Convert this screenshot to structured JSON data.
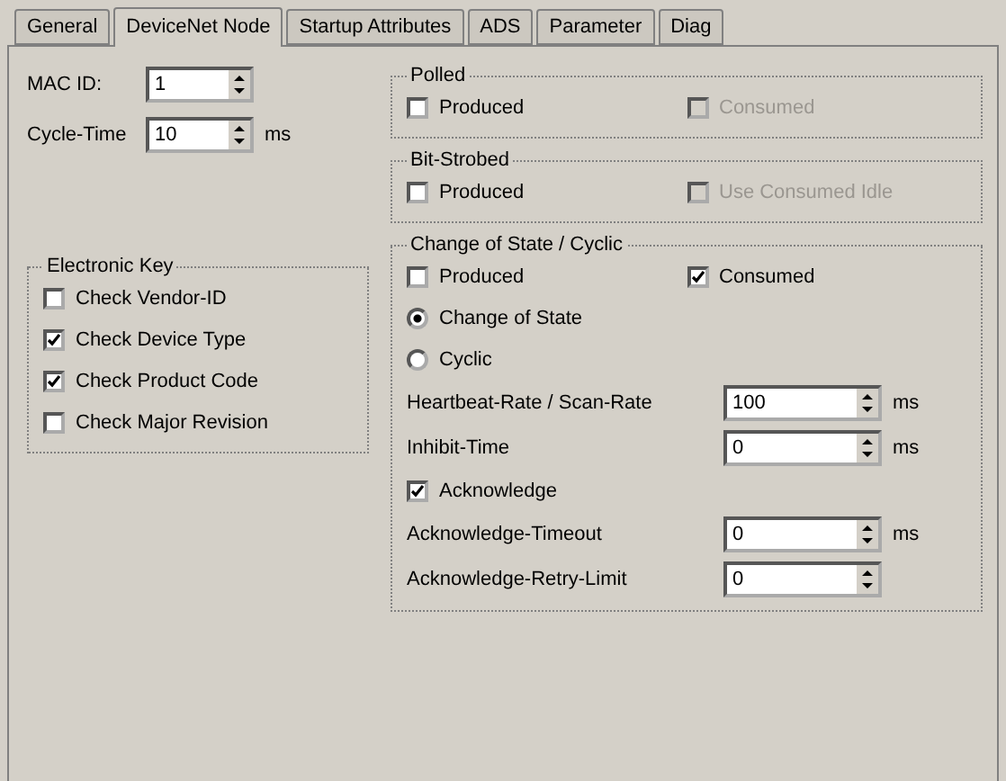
{
  "tabs": [
    {
      "label": "General",
      "selected": false
    },
    {
      "label": "DeviceNet Node",
      "selected": true
    },
    {
      "label": "Startup Attributes",
      "selected": false
    },
    {
      "label": "ADS",
      "selected": false
    },
    {
      "label": "Parameter",
      "selected": false
    },
    {
      "label": "Diag",
      "selected": false
    }
  ],
  "node": {
    "mac_id": {
      "label": "MAC ID:",
      "value": "1"
    },
    "cycle_time": {
      "label": "Cycle-Time",
      "value": "10",
      "unit": "ms"
    }
  },
  "electronic_key": {
    "title": "Electronic Key",
    "items": [
      {
        "label": "Check Vendor-ID",
        "checked": false
      },
      {
        "label": "Check Device Type",
        "checked": true
      },
      {
        "label": "Check Product Code",
        "checked": true
      },
      {
        "label": "Check Major Revision",
        "checked": false
      }
    ]
  },
  "polled": {
    "title": "Polled",
    "options": [
      {
        "label": "Produced",
        "checked": false,
        "disabled": false
      },
      {
        "label": "Consumed",
        "checked": false,
        "disabled": true
      }
    ]
  },
  "bit_strobed": {
    "title": "Bit-Strobed",
    "options": [
      {
        "label": "Produced",
        "checked": false,
        "disabled": false
      },
      {
        "label": "Use Consumed Idle",
        "checked": false,
        "disabled": true
      }
    ]
  },
  "cos": {
    "title": "Change of State / Cyclic",
    "options": [
      {
        "label": "Produced",
        "checked": false,
        "disabled": false
      },
      {
        "label": "Consumed",
        "checked": true,
        "disabled": false
      }
    ],
    "modes": [
      {
        "label": "Change of State",
        "selected": true
      },
      {
        "label": "Cyclic",
        "selected": false
      }
    ],
    "fields": [
      {
        "kind": "spin",
        "label": "Heartbeat-Rate / Scan-Rate",
        "value": "100",
        "unit": "ms"
      },
      {
        "kind": "spin",
        "label": "Inhibit-Time",
        "value": "0",
        "unit": "ms"
      },
      {
        "kind": "check",
        "label": "Acknowledge",
        "checked": true
      },
      {
        "kind": "spin",
        "label": "Acknowledge-Timeout",
        "value": "0",
        "unit": "ms"
      },
      {
        "kind": "spin",
        "label": "Acknowledge-Retry-Limit",
        "value": "0"
      }
    ]
  }
}
